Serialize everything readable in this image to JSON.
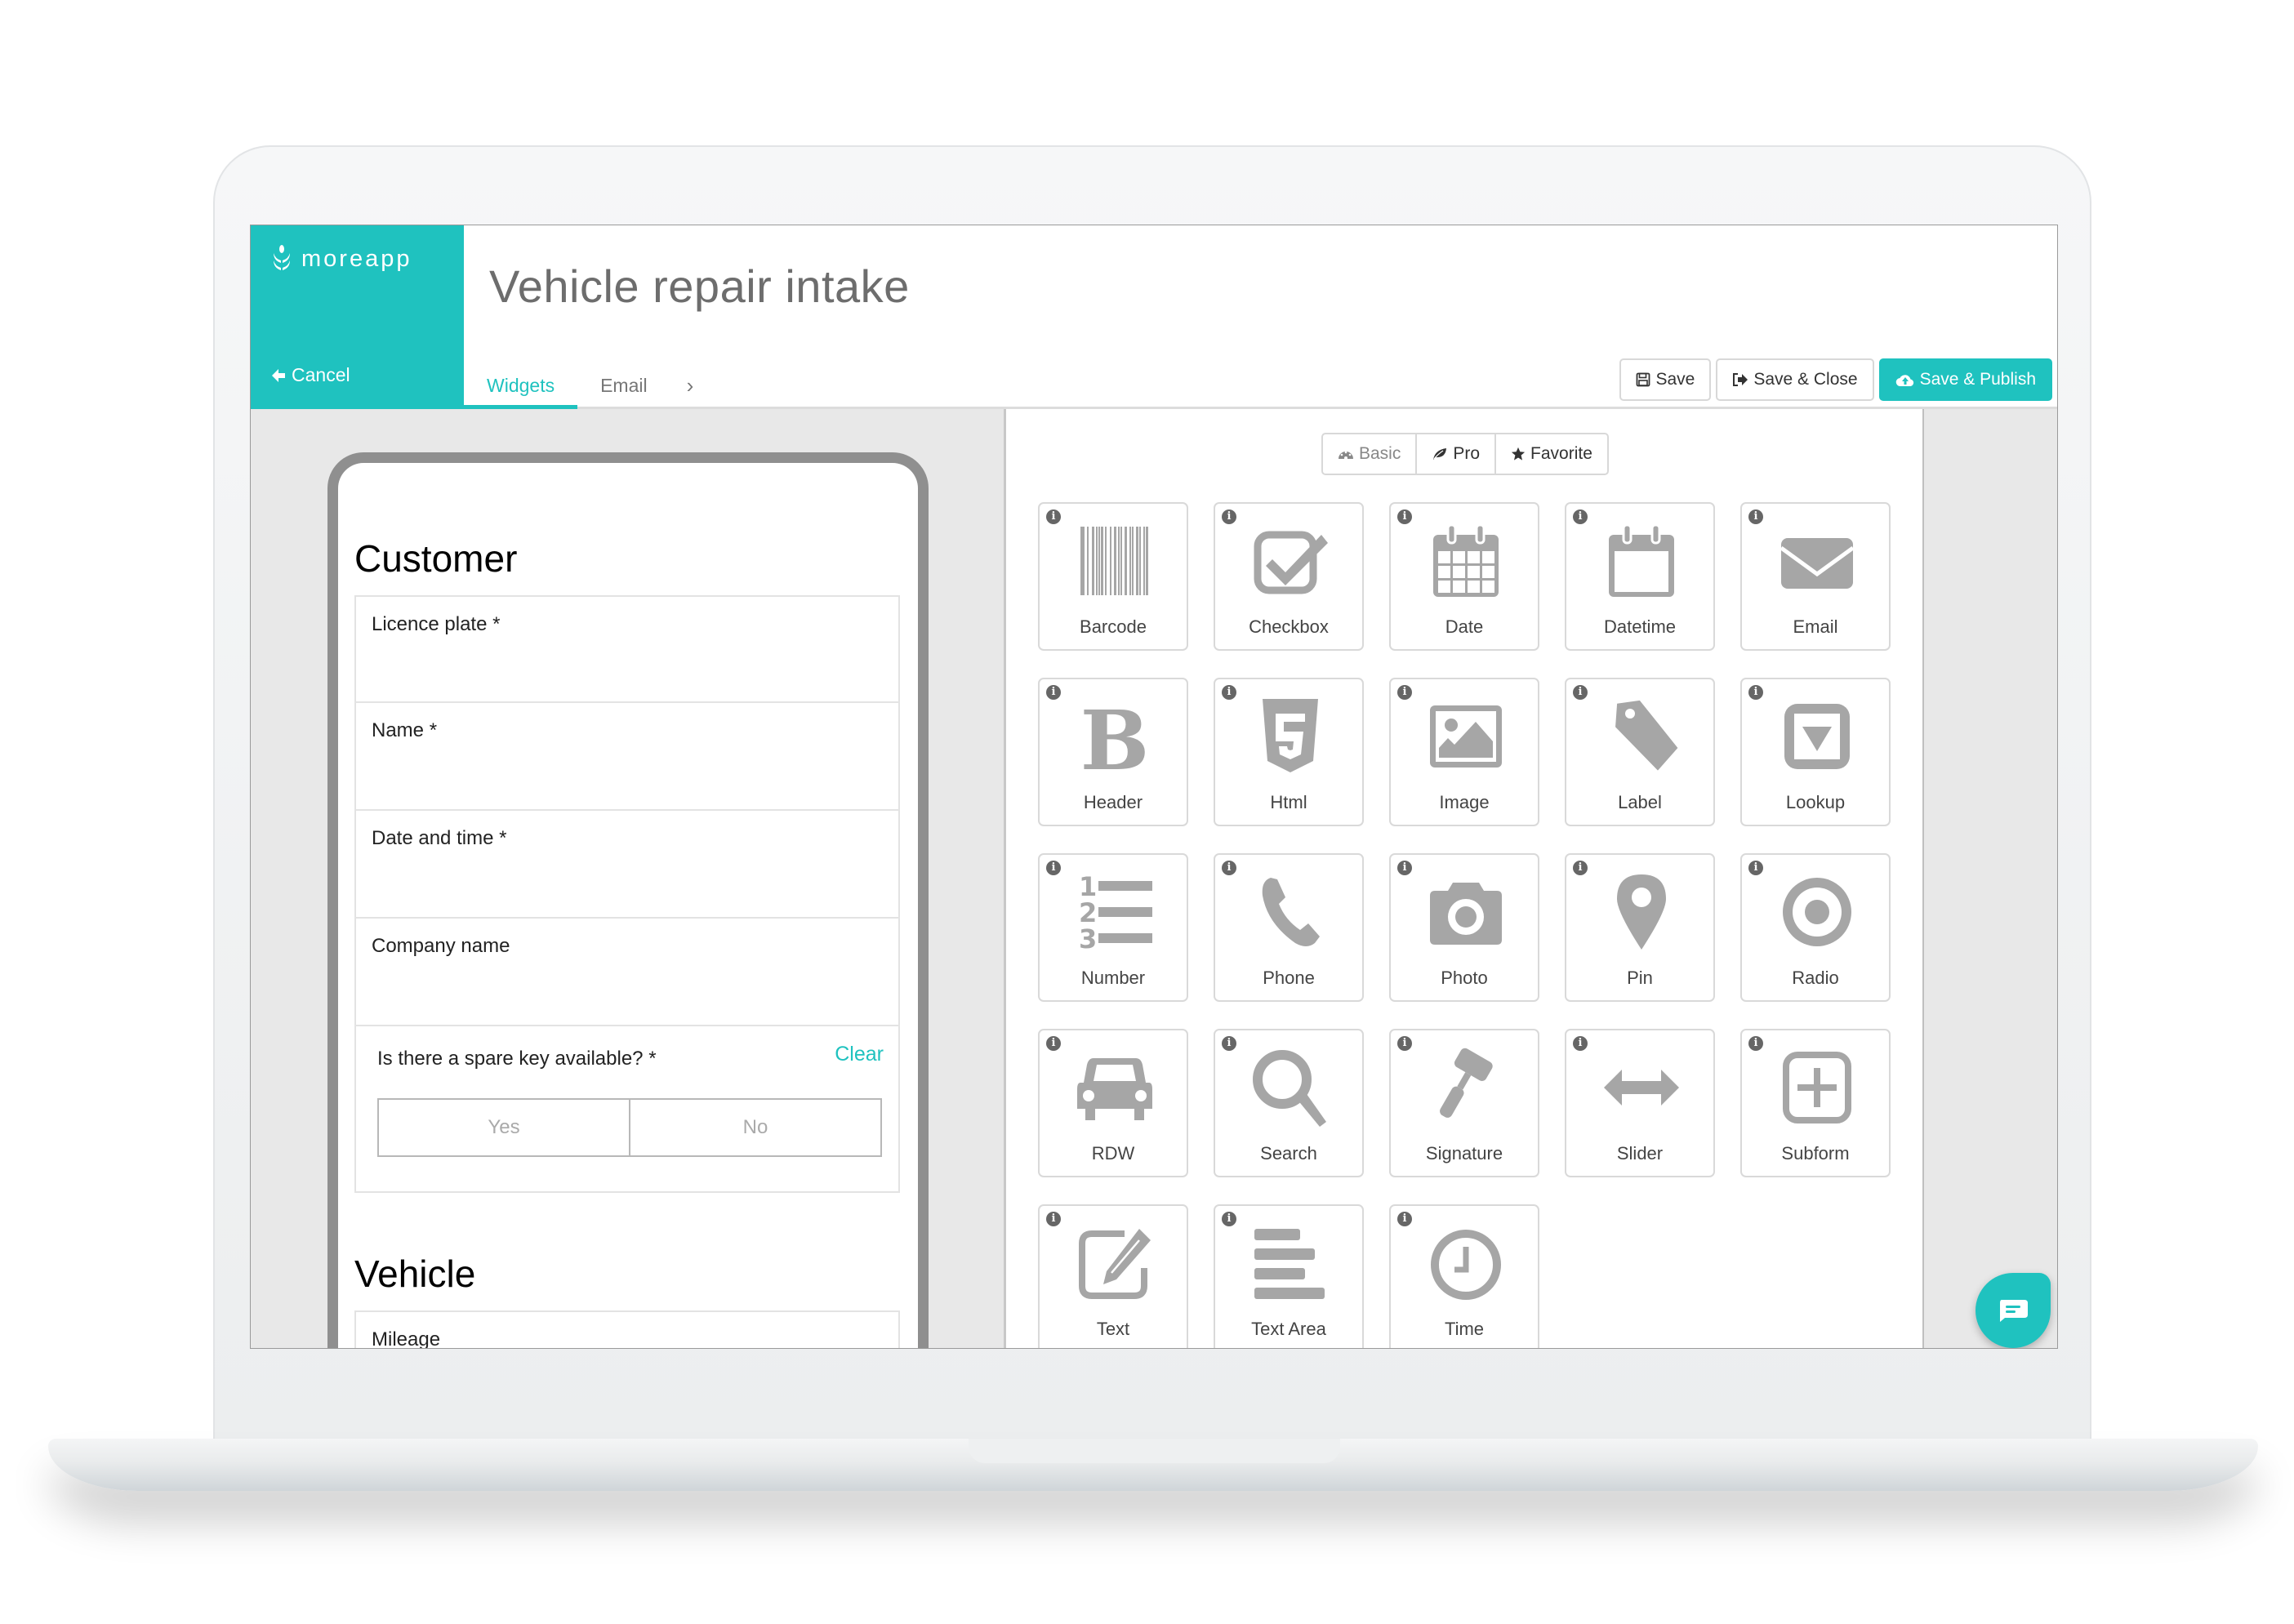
{
  "brand": {
    "name": "moreapp",
    "color": "#1fc2bf"
  },
  "header": {
    "title": "Vehicle repair intake",
    "cancel_label": "Cancel",
    "tabs": [
      {
        "label": "Widgets",
        "active": true
      },
      {
        "label": "Email",
        "active": false
      }
    ],
    "tab_more_icon": "chevron-right-icon",
    "actions": {
      "save": "Save",
      "save_close": "Save & Close",
      "save_publish": "Save & Publish"
    }
  },
  "form_preview": {
    "sections": [
      {
        "title": "Customer",
        "fields": [
          {
            "label": "Licence plate *"
          },
          {
            "label": "Name *"
          },
          {
            "label": "Date and time *"
          },
          {
            "label": "Company name"
          }
        ],
        "radio": {
          "question": "Is there a spare key available? *",
          "clear_label": "Clear",
          "options": [
            "Yes",
            "No"
          ]
        }
      },
      {
        "title": "Vehicle",
        "fields": [
          {
            "label": "Mileage"
          }
        ]
      }
    ]
  },
  "widgets_panel": {
    "filters": [
      {
        "label": "Basic",
        "icon": "dashboard-icon"
      },
      {
        "label": "Pro",
        "icon": "leaf-icon"
      },
      {
        "label": "Favorite",
        "icon": "star-icon"
      }
    ],
    "widgets": [
      {
        "label": "Barcode",
        "icon": "barcode"
      },
      {
        "label": "Checkbox",
        "icon": "checkbox"
      },
      {
        "label": "Date",
        "icon": "date"
      },
      {
        "label": "Datetime",
        "icon": "datetime"
      },
      {
        "label": "Email",
        "icon": "email"
      },
      {
        "label": "Header",
        "icon": "header"
      },
      {
        "label": "Html",
        "icon": "html"
      },
      {
        "label": "Image",
        "icon": "image"
      },
      {
        "label": "Label",
        "icon": "label"
      },
      {
        "label": "Lookup",
        "icon": "lookup"
      },
      {
        "label": "Number",
        "icon": "number"
      },
      {
        "label": "Phone",
        "icon": "phone"
      },
      {
        "label": "Photo",
        "icon": "photo"
      },
      {
        "label": "Pin",
        "icon": "pin"
      },
      {
        "label": "Radio",
        "icon": "radio"
      },
      {
        "label": "RDW",
        "icon": "car"
      },
      {
        "label": "Search",
        "icon": "search"
      },
      {
        "label": "Signature",
        "icon": "gavel"
      },
      {
        "label": "Slider",
        "icon": "slider"
      },
      {
        "label": "Subform",
        "icon": "subform"
      },
      {
        "label": "Text",
        "icon": "text"
      },
      {
        "label": "Text Area",
        "icon": "textarea"
      },
      {
        "label": "Time",
        "icon": "time"
      }
    ],
    "info_glyph": "i"
  },
  "chat_button": {
    "icon": "chat-icon"
  }
}
